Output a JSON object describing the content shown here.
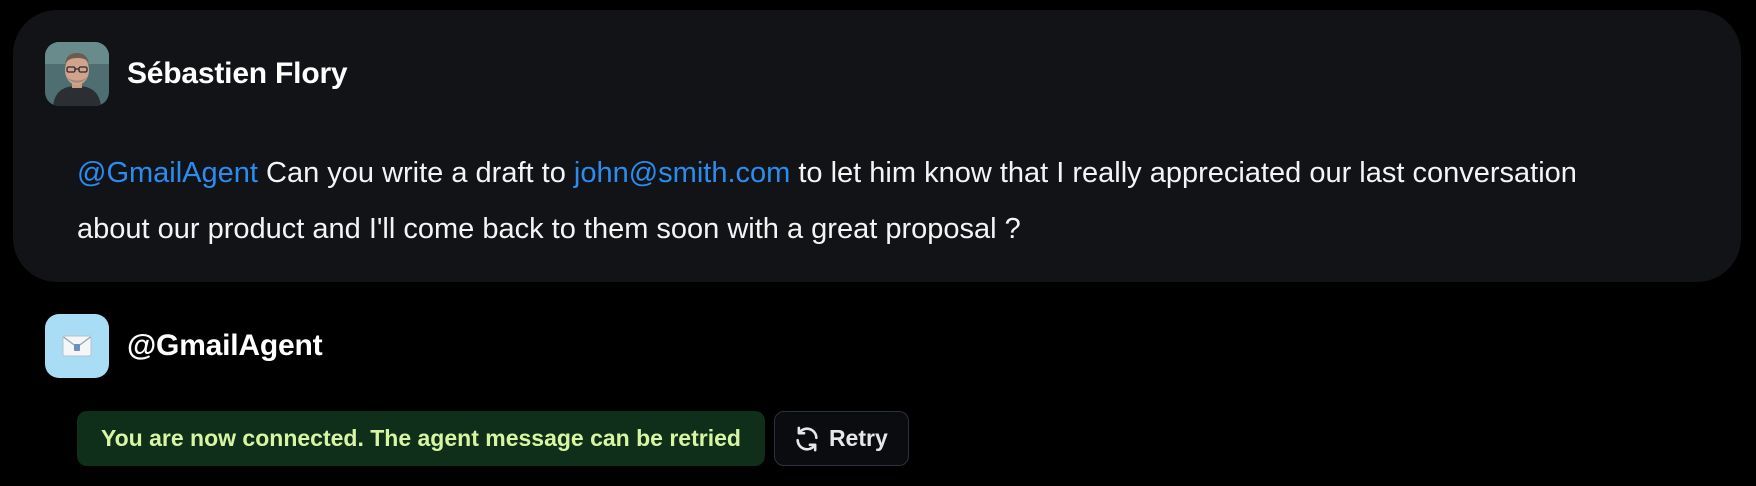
{
  "user_message": {
    "author": "Sébastien Flory",
    "avatar_icon": "person-avatar",
    "parts": {
      "mention": "@GmailAgent",
      "text1": " Can you write a draft to ",
      "email": "john@smith.com",
      "text2": " to let him know that I really appreciated our last conversation about our product and I'll come back to them soon with a great proposal ?"
    }
  },
  "agent": {
    "name": "@GmailAgent",
    "avatar_icon": "envelope-icon"
  },
  "status": {
    "message": "You are now connected. The agent message can be retried"
  },
  "retry": {
    "label": "Retry",
    "icon": "refresh-icon"
  },
  "colors": {
    "background": "#000000",
    "card": "#111316",
    "accent_link": "#2b8cf0",
    "status_bg": "#0f2f1a",
    "status_text": "#d7f5a2",
    "agent_avatar_bg": "#a9dcf5"
  }
}
